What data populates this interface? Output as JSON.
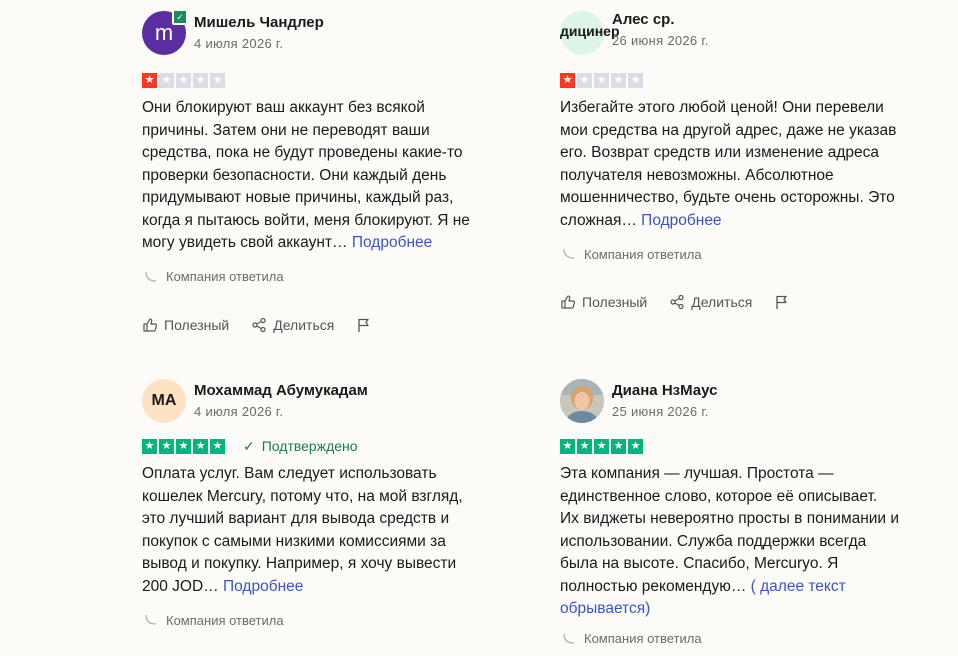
{
  "reviews": [
    {
      "avatar_text": "m",
      "name": "Мишель Чандлер",
      "date": "4 июля 2026 г.",
      "stars": 1,
      "body": "Они блокируют ваш аккаунт без всякой причины. Затем они не переводят ваши средства, пока не будут проведены какие-то проверки безопасности. Они каждый день придумывают новые причины, каждый раз, когда я пытаюсь войти, меня блокируют. Я не могу увидеть свой аккаунт…",
      "more": "Подробнее",
      "replied": "Компания ответила",
      "useful": "Полезный",
      "share": "Делиться"
    },
    {
      "avatar_text": "дицинер",
      "name": "Алес ср.",
      "date": "26 июня 2026 г.",
      "stars": 1,
      "body": "Избегайте этого любой ценой! Они перевели мои средства на другой адрес, даже не указав его. Возврат средств или изменение адреса получателя невозможны. Абсолютное мошенничество, будьте очень осторожны. Это сложная…",
      "more": "Подробнее",
      "replied": "Компания ответила",
      "useful": "Полезный",
      "share": "Делиться"
    },
    {
      "avatar_text": "MA",
      "name": "Мохаммад Абумукадам",
      "date": "4 июля 2026 г.",
      "stars": 5,
      "verified": "Подтверждено",
      "body": "Оплата услуг. Вам следует использовать кошелек Mercury, потому что, на мой взгляд, это лучший вариант для вывода средств и покупок с самыми низкими комиссиями за вывод и покупку. Например, я хочу вывести 200 JOD…",
      "more": "Подробнее",
      "replied": "Компания ответила"
    },
    {
      "name": "Диана НзМаус",
      "date": "25 июня 2026 г.",
      "stars": 5,
      "body": "Эта компания — лучшая. Простота — единственное слово, которое её описывает. Их виджеты невероятно просты в понимании и использовании. Служба поддержки всегда была на высоте. Спасибо, Mercuryo. Я полностью рекомендую…",
      "more": "( далее текст обрывается)",
      "replied": "Компания ответила"
    }
  ],
  "colors": {
    "star_red": "#ff3722",
    "star_green": "#00b67a",
    "star_empty": "#dcdce6",
    "link": "#3955c4",
    "verified_green": "#1c7a50",
    "avatar_purple": "#5a2da0"
  },
  "icons": {
    "star": "star-icon",
    "thumbs_up": "thumbs-up-icon",
    "share": "share-icon",
    "flag": "flag-icon",
    "reply_curve": "reply-curve-icon",
    "check": "check-icon"
  }
}
